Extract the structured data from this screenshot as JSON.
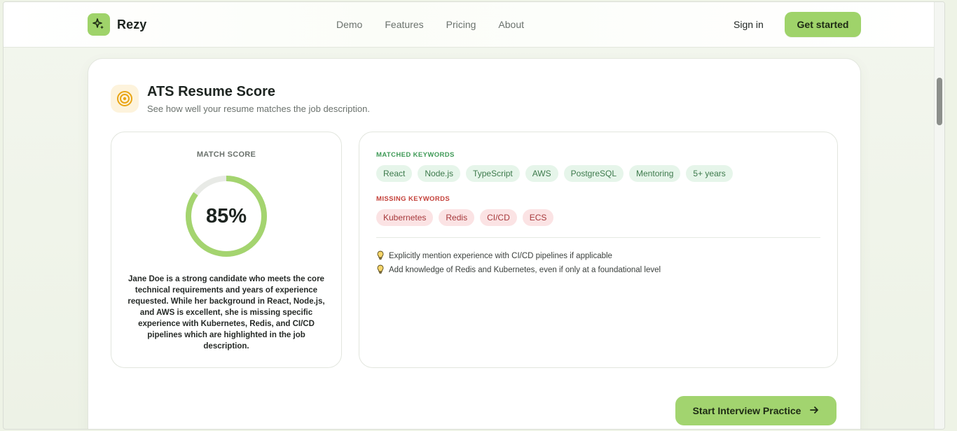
{
  "brand": {
    "name": "Rezy",
    "icon": "sparkle-icon",
    "accent": "#9fd36a"
  },
  "nav": {
    "items": [
      "Demo",
      "Features",
      "Pricing",
      "About"
    ]
  },
  "header": {
    "sign_in": "Sign in",
    "get_started": "Get started"
  },
  "card": {
    "icon": "target-icon",
    "title": "ATS Resume Score",
    "subtitle": "See how well your resume matches the job description."
  },
  "score": {
    "label": "MATCH SCORE",
    "value": 85,
    "display": "85%",
    "summary": "Jane Doe is a strong candidate who meets the core technical requirements and years of experience requested. While her background in React, Node.js, and AWS is excellent, she is missing specific experience with Kubernetes, Redis, and CI/CD pipelines which are highlighted in the job description."
  },
  "keywords": {
    "matched_label": "MATCHED KEYWORDS",
    "matched": [
      "React",
      "Node.js",
      "TypeScript",
      "AWS",
      "PostgreSQL",
      "Mentoring",
      "5+ years"
    ],
    "missing_label": "MISSING KEYWORDS",
    "missing": [
      "Kubernetes",
      "Redis",
      "CI/CD",
      "ECS"
    ],
    "colors": {
      "matched": "#3f9a57",
      "missing": "#c4413a"
    }
  },
  "tips": {
    "icon": "lightbulb-icon",
    "items": [
      "Explicitly mention experience with CI/CD pipelines if applicable",
      "Add knowledge of Redis and Kubernetes, even if only at a foundational level"
    ]
  },
  "cta": {
    "label": "Start Interview Practice",
    "icon": "arrow-right-icon"
  }
}
